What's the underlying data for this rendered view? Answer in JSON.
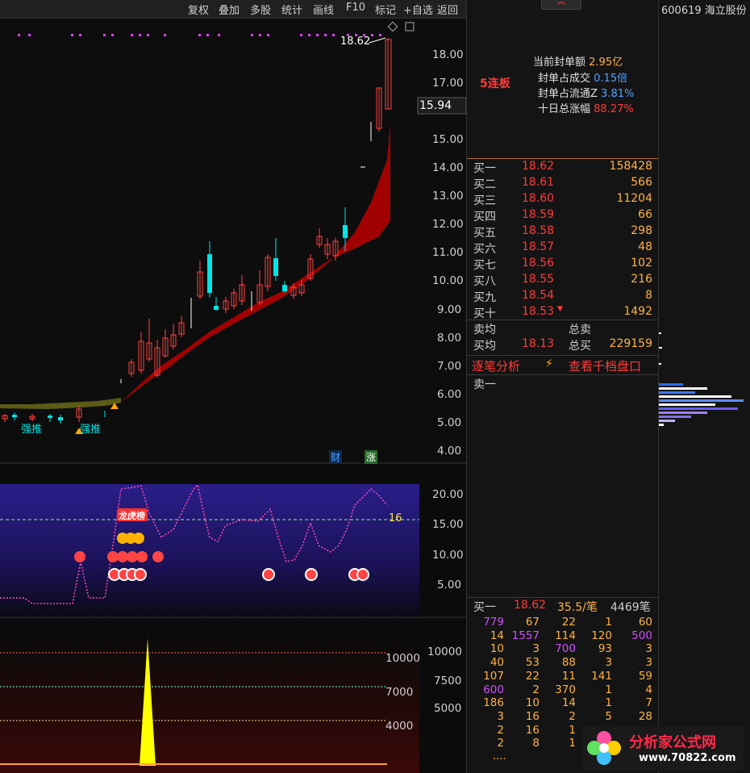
{
  "toolbar": {
    "items": [
      "复权",
      "叠加",
      "多股",
      "统计",
      "画线",
      "F10",
      "标记",
      "+自选",
      "返回"
    ]
  },
  "stock": {
    "code_name": "600619 海立股份"
  },
  "main_chart": {
    "high_label": "18.62",
    "current_price": "15.94",
    "y_ticks": [
      "18.00",
      "17.00",
      "15.00",
      "14.00",
      "13.00",
      "12.00",
      "11.00",
      "10.00",
      "9.00",
      "8.00",
      "7.00",
      "6.00",
      "5.00",
      "4.00"
    ],
    "annotations": [
      "强推",
      "强推"
    ],
    "badges": [
      "财",
      "涨"
    ]
  },
  "indicator_chart": {
    "level_label": "16",
    "y_ticks": [
      "20.00",
      "15.00",
      "10.00",
      "5.00"
    ],
    "tag_label": "龙虎榜"
  },
  "volume_chart": {
    "y_ticks": [
      "10000",
      "7500",
      "5000"
    ],
    "line_labels": [
      "10000",
      "7000",
      "4000"
    ]
  },
  "summary": {
    "board_label": "5连板",
    "rows": [
      {
        "label": "当前封单额",
        "value": "2.95亿",
        "color": "#ffb347"
      },
      {
        "label": "封单占成交",
        "value": "0.15倍",
        "color": "#4fa3ff"
      },
      {
        "label": "封单占流通Z",
        "value": "3.81%",
        "color": "#4fa3ff"
      },
      {
        "label": "十日总涨幅",
        "value": "88.27%",
        "color": "#ff3b3b"
      }
    ]
  },
  "order_book": {
    "bids": [
      {
        "label": "买一",
        "price": "18.62",
        "volume": "158428"
      },
      {
        "label": "买二",
        "price": "18.61",
        "volume": "566"
      },
      {
        "label": "买三",
        "price": "18.60",
        "volume": "11204"
      },
      {
        "label": "买四",
        "price": "18.59",
        "volume": "66"
      },
      {
        "label": "买五",
        "price": "18.58",
        "volume": "298"
      },
      {
        "label": "买六",
        "price": "18.57",
        "volume": "48"
      },
      {
        "label": "买七",
        "price": "18.56",
        "volume": "102"
      },
      {
        "label": "买八",
        "price": "18.55",
        "volume": "216"
      },
      {
        "label": "买九",
        "price": "18.54",
        "volume": "8"
      },
      {
        "label": "买十",
        "price": "18.53",
        "volume": "1492"
      }
    ],
    "sell_avg_label": "卖均",
    "buy_avg_label": "买均",
    "buy_avg_price": "18.13",
    "total_sell_label": "总卖",
    "total_buy_label": "总买",
    "total_buy_value": "229159"
  },
  "actions": {
    "tick_analysis": "逐笔分析",
    "view_depth": "查看千档盘口"
  },
  "ask_label": "卖一",
  "queue": {
    "label": "买一",
    "price": "18.62",
    "avg": "35.5/笔",
    "count": "4469笔",
    "rows": [
      [
        "779",
        "67",
        "22",
        "1",
        "60"
      ],
      [
        "14",
        "1557",
        "114",
        "120",
        "500"
      ],
      [
        "10",
        "3",
        "700",
        "93",
        "3"
      ],
      [
        "40",
        "53",
        "88",
        "3",
        "3"
      ],
      [
        "107",
        "22",
        "11",
        "141",
        "59"
      ],
      [
        "600",
        "2",
        "370",
        "1",
        "4"
      ],
      [
        "186",
        "10",
        "14",
        "1",
        "7"
      ],
      [
        "3",
        "16",
        "2",
        "5",
        "28"
      ],
      [
        "2",
        "16",
        "1",
        "",
        ""
      ],
      [
        "2",
        "8",
        "1",
        "",
        ""
      ]
    ],
    "more": "...."
  },
  "watermark": {
    "text": "分析家公式网www.70822.com",
    "logo_title": "分析家公式网",
    "logo_url": "www.70822.com"
  }
}
